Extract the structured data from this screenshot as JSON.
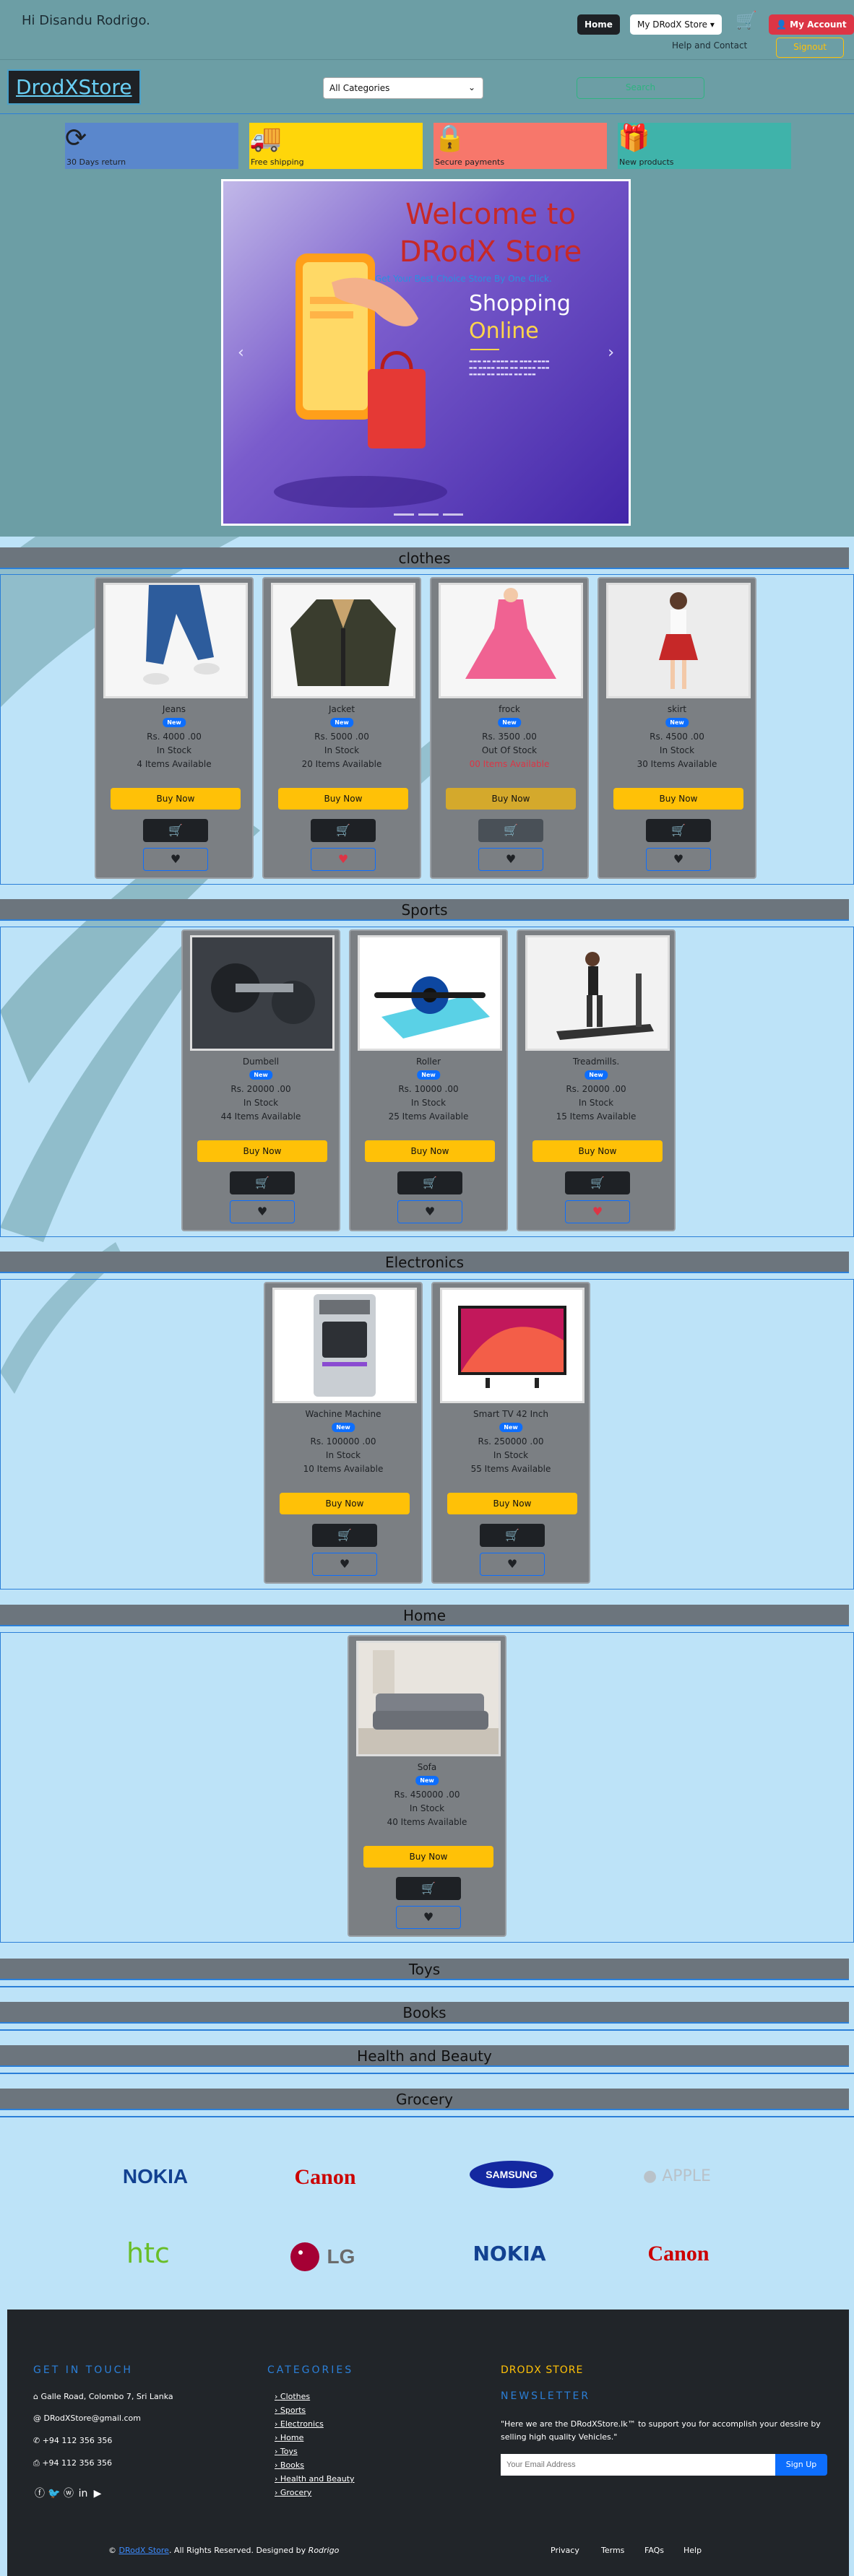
{
  "header": {
    "greeting": "Hi Disandu Rodrigo.",
    "home_label": "Home",
    "store_menu_label": "My DRodX Store",
    "account_label": "My Account",
    "help_label": "Help and Contact",
    "signout_label": "Signout"
  },
  "search": {
    "logo": "DrodXStore",
    "category_selected": "All Categories",
    "search_label": "Search"
  },
  "features": [
    {
      "label": "30 Days return",
      "icon": "refresh-icon",
      "color": "#5a87cc"
    },
    {
      "label": "Free shipping",
      "icon": "truck-icon",
      "color": "#ffd60a"
    },
    {
      "label": "Secure payments",
      "icon": "lock-icon",
      "color": "#f7776b"
    },
    {
      "label": "New products",
      "icon": "gift-icon",
      "color": "#3fb3aa"
    }
  ],
  "hero": {
    "title": "Welcome to DRodX Store",
    "subtitle": "Get Your Best Choice Store By One Click.",
    "shopping": "Shopping",
    "online": "Online"
  },
  "sections": [
    {
      "title": "clothes",
      "products": [
        {
          "name": "Jeans",
          "badge": "New",
          "price": "Rs. 4000 .00",
          "stock": "In Stock",
          "available": "4 Items Available",
          "buy": "Buy Now",
          "favorite": false
        },
        {
          "name": "Jacket",
          "badge": "New",
          "price": "Rs. 5000 .00",
          "stock": "In Stock",
          "available": "20 Items Available",
          "buy": "Buy Now",
          "favorite": true
        },
        {
          "name": "frock",
          "badge": "New",
          "price": "Rs. 3500 .00",
          "stock": "Out Of Stock",
          "available": "00 Items Available",
          "buy": "Buy Now",
          "favorite": false
        },
        {
          "name": "skirt",
          "badge": "New",
          "price": "Rs. 4500 .00",
          "stock": "In Stock",
          "available": "30 Items Available",
          "buy": "Buy Now",
          "favorite": false
        }
      ]
    },
    {
      "title": "Sports",
      "products": [
        {
          "name": "Dumbell",
          "badge": "New",
          "price": "Rs. 20000 .00",
          "stock": "In Stock",
          "available": "44 Items Available",
          "buy": "Buy Now",
          "favorite": false
        },
        {
          "name": "Roller",
          "badge": "New",
          "price": "Rs. 10000 .00",
          "stock": "In Stock",
          "available": "25 Items Available",
          "buy": "Buy Now",
          "favorite": false
        },
        {
          "name": "Treadmills.",
          "badge": "New",
          "price": "Rs. 20000 .00",
          "stock": "In Stock",
          "available": "15 Items Available",
          "buy": "Buy Now",
          "favorite": true
        }
      ]
    },
    {
      "title": "Electronics",
      "products": [
        {
          "name": "Wachine Machine",
          "badge": "New",
          "price": "Rs. 100000 .00",
          "stock": "In Stock",
          "available": "10 Items Available",
          "buy": "Buy Now",
          "favorite": false
        },
        {
          "name": "Smart TV 42 Inch",
          "badge": "New",
          "price": "Rs. 250000 .00",
          "stock": "In Stock",
          "available": "55 Items Available",
          "buy": "Buy Now",
          "favorite": false
        }
      ]
    },
    {
      "title": "Home",
      "products": [
        {
          "name": "Sofa",
          "badge": "New",
          "price": "Rs. 450000 .00",
          "stock": "In Stock",
          "available": "40 Items Available",
          "buy": "Buy Now",
          "favorite": false
        }
      ]
    },
    {
      "title": "Toys",
      "products": []
    },
    {
      "title": "Books",
      "products": []
    },
    {
      "title": "Health and Beauty",
      "products": []
    },
    {
      "title": "Grocery",
      "products": []
    }
  ],
  "brands": [
    {
      "name": "NOKIA",
      "color": "#124191"
    },
    {
      "name": "Canon",
      "color": "#cc0000"
    },
    {
      "name": "SAMSUNG",
      "color": "#1428a0"
    },
    {
      "name": "APPLE",
      "color": "#b9c2c9"
    },
    {
      "name": "htc",
      "color": "#69be28"
    },
    {
      "name": "LG",
      "color": "#a50034"
    },
    {
      "name": "NOKIA",
      "color": "#124191"
    },
    {
      "name": "Canon",
      "color": "#cc0000"
    }
  ],
  "footer": {
    "contact_heading": "GET IN TOUCH",
    "address": "Galle Road, Colombo 7, Sri Lanka",
    "email": "DRodXStore@gmail.com",
    "phone1": "+94 112 356 356",
    "phone2": "+94 112 356 356",
    "categories_heading": "CATEGORIES",
    "categories": [
      "Clothes",
      "Sports",
      "Electronics",
      "Home",
      "Toys",
      "Books",
      "Health and Beauty",
      "Grocery"
    ],
    "store_heading": "DRODX STORE",
    "newsletter_heading": "NEWSLETTER",
    "tagline": "\"Here we are the DRodXStore.lk™ to support you for accomplish your dessire by selling high quality Vehicles.\"",
    "email_placeholder": "Your Email Address",
    "signup_label": "Sign Up",
    "copyright_prefix": "©",
    "copyright_store": "DRodX Store",
    "copyright_text": ". All Rights Reserved. Designed by",
    "designer": "Rodrigo",
    "links": [
      "Privacy",
      "Terms",
      "FAQs",
      "Help"
    ]
  }
}
